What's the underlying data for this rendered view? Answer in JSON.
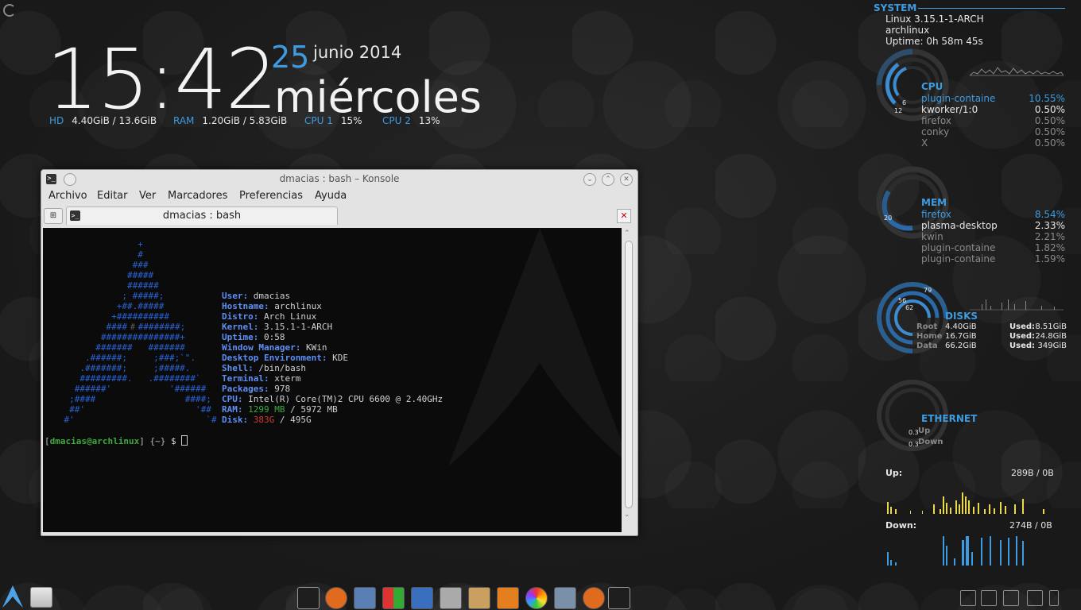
{
  "clock": {
    "time": "15:42",
    "day": "25",
    "month_year": "junio 2014",
    "weekday": "miércoles"
  },
  "stats": [
    {
      "label": "HD",
      "value": "4.40GiB / 13.6GiB"
    },
    {
      "label": "RAM",
      "value": "1.20GiB / 5.83GiB"
    },
    {
      "label": "CPU 1",
      "value": "15%"
    },
    {
      "label": "CPU 2",
      "value": "13%"
    }
  ],
  "konsole": {
    "title": "dmacias : bash – Konsole",
    "menu": [
      "Archivo",
      "Editar",
      "Ver",
      "Marcadores",
      "Preferencias",
      "Ayuda"
    ],
    "tab_label": "dmacias : bash",
    "logo": [
      "                  +",
      "                  #",
      "                 ###",
      "                #####",
      "                ######",
      "               ; #####;",
      "              +##.#####",
      "             +##########",
      "            #####️########;",
      "           ###############+",
      "          #######   #######",
      "        .######;     ;###;`\".",
      "       .#######;     ;#####.",
      "       #########.   .########`",
      "      ######'           '######",
      "     ;####                 ####;",
      "     ##'                     '##",
      "    #'                         `#"
    ],
    "info": [
      {
        "k": "User:",
        "v": "dmacias"
      },
      {
        "k": "Hostname:",
        "v": "archlinux"
      },
      {
        "k": "Distro:",
        "v": "Arch Linux"
      },
      {
        "k": "Kernel:",
        "v": "3.15.1-1-ARCH"
      },
      {
        "k": "Uptime:",
        "v": "0:58"
      },
      {
        "k": "Window Manager:",
        "v": "KWin"
      },
      {
        "k": "Desktop Environment:",
        "v": "KDE"
      },
      {
        "k": "Shell:",
        "v": "/bin/bash"
      },
      {
        "k": "Terminal:",
        "v": "xterm"
      },
      {
        "k": "Packages:",
        "v": "978"
      },
      {
        "k": "CPU:",
        "v": "Intel(R) Core(TM)2 CPU 6600 @ 2.40GHz"
      }
    ],
    "ram": {
      "k": "RAM:",
      "used": "1299 MB",
      "total": " / 5972 MB"
    },
    "disk": {
      "k": "Disk:",
      "used": "383G",
      "total": " / 495G"
    },
    "prompt": {
      "user": "dmacias@archlinux",
      "dir": "{~}",
      "sym": "$"
    }
  },
  "conky": {
    "system_title": "SYSTEM",
    "kernel": "Linux 3.15.1-1-ARCH",
    "hostname": "archlinux",
    "uptime": "Uptime: 0h 58m 45s",
    "cpu": {
      "title": "CPU",
      "ring_labels": [
        "6",
        "12"
      ],
      "procs": [
        {
          "name": "plugin-containe",
          "val": "10.55%"
        },
        {
          "name": "kworker/1:0",
          "val": "0.50%"
        },
        {
          "name": "firefox",
          "val": "0.50%"
        },
        {
          "name": "conky",
          "val": "0.50%"
        },
        {
          "name": "X",
          "val": "0.50%"
        }
      ]
    },
    "mem": {
      "title": "MEM",
      "ring_label": "20",
      "procs": [
        {
          "name": "firefox",
          "val": "8.54%"
        },
        {
          "name": "plasma-desktop",
          "val": "2.33%"
        },
        {
          "name": "kwin",
          "val": "2.21%"
        },
        {
          "name": "plugin-containe",
          "val": "1.82%"
        },
        {
          "name": "plugin-containe",
          "val": "1.59%"
        }
      ]
    },
    "disks": {
      "title": "DISKS",
      "ring_labels": [
        "79",
        "56",
        "62"
      ],
      "rows": [
        {
          "name": "Root",
          "free": "4.40GiB",
          "used": "8.51GiB"
        },
        {
          "name": "Home",
          "free": "16.7GiB",
          "used": "24.8GiB"
        },
        {
          "name": "Data",
          "free": "66.2GiB",
          "used": "349GiB"
        }
      ],
      "used_label": "Used:"
    },
    "ethernet": {
      "title": "ETHERNET",
      "up_label": "Up",
      "down_label": "Down",
      "up_val": "0.3",
      "down_val": "0.3"
    },
    "up": {
      "label": "Up:",
      "value": "289B  / 0B"
    },
    "down": {
      "label": "Down:",
      "value": "274B  / 0B"
    }
  },
  "taskbar": {
    "apps": [
      "terminal-icon",
      "firefox-icon",
      "thunderbird-icon",
      "office-icon",
      "arabic-app-icon",
      "inkscape-icon",
      "paint-icon",
      "blender-icon",
      "color-wheel-icon",
      "video-editor-icon",
      "firefox-icon",
      "konsole-icon"
    ],
    "tray": [
      "clipboard-icon",
      "volume-icon",
      "display-icon",
      "network-icon",
      "tray-arrow-icon"
    ]
  }
}
